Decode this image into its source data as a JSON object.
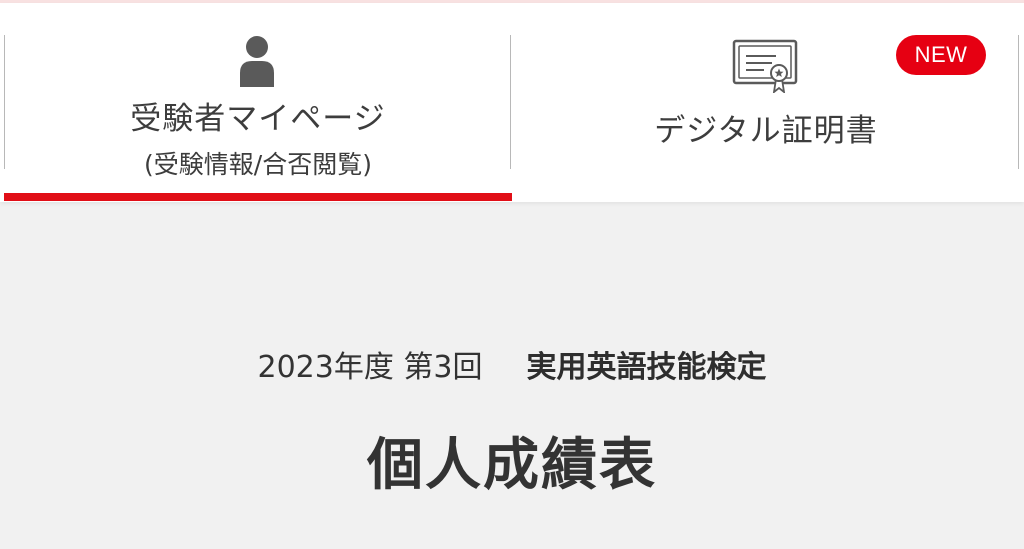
{
  "nav": {
    "tabs": [
      {
        "label": "受験者マイページ",
        "sublabel": "(受験情報/合否閲覧)",
        "icon": "person-icon",
        "active": true
      },
      {
        "label": "デジタル証明書",
        "icon": "certificate-icon",
        "badge": "NEW",
        "active": false
      }
    ],
    "active_color": "#e10e17",
    "badge_color": "#e60012"
  },
  "main": {
    "year_round": "2023年度 第3回",
    "exam_name": "実用英語技能検定",
    "title": "個人成績表"
  }
}
